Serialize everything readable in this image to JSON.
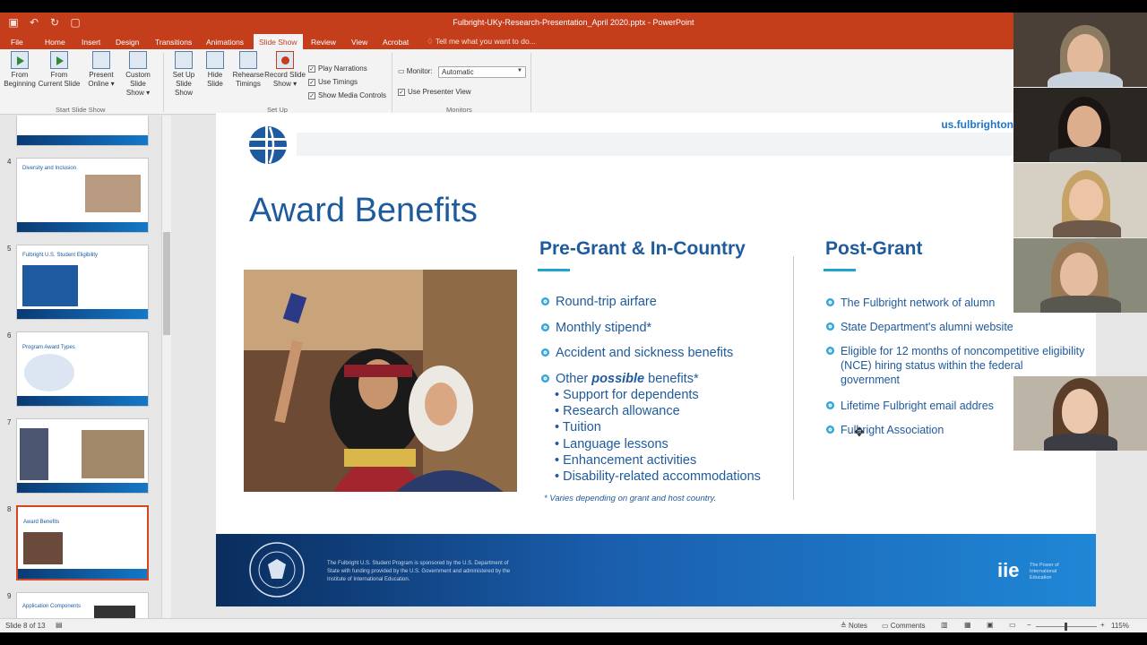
{
  "window": {
    "title": "Fulbright-UKy-Research-Presentation_April 2020.pptx  -  PowerPoint"
  },
  "tabs": [
    "File",
    "Home",
    "Insert",
    "Design",
    "Transitions",
    "Animations",
    "Slide Show",
    "Review",
    "View",
    "Acrobat"
  ],
  "active_tab": "Slide Show",
  "tell_me": "Tell me what you want to do...",
  "ribbon": {
    "start": {
      "from_beginning": [
        "From",
        "Beginning"
      ],
      "from_current": [
        "From",
        "Current Slide"
      ],
      "present_online": [
        "Present",
        "Online ▾"
      ],
      "custom": [
        "Custom Slide",
        "Show ▾"
      ],
      "group": "Start Slide Show"
    },
    "setup": {
      "setup_show": [
        "Set Up",
        "Slide Show"
      ],
      "hide": [
        "Hide",
        "Slide"
      ],
      "rehearse": [
        "Rehearse",
        "Timings"
      ],
      "record": [
        "Record Slide",
        "Show ▾"
      ],
      "group": "Set Up",
      "checks": [
        "Play Narrations",
        "Use Timings",
        "Show Media Controls"
      ]
    },
    "monitors": {
      "label": "Monitor:",
      "value": "Automatic",
      "presenter_view": "Use Presenter View",
      "group": "Monitors"
    }
  },
  "thumbnails": [
    {
      "num": "4",
      "title": "Diversity and Inclusion"
    },
    {
      "num": "5",
      "title": "Fulbright U.S. Student Eligibility"
    },
    {
      "num": "6",
      "title": "Program Award Types"
    },
    {
      "num": "7",
      "title": ""
    },
    {
      "num": "8",
      "title": "Award Benefits"
    },
    {
      "num": "9",
      "title": "Application Components"
    }
  ],
  "slide": {
    "url": "us.fulbrighton",
    "title": "Award Benefits",
    "col1_heading": "Pre-Grant & In-Country",
    "col1_bullets": [
      "Round-trip airfare",
      "Monthly stipend*",
      "Accident and sickness benefits"
    ],
    "other_prefix": "Other ",
    "other_em": "possible",
    "other_suffix": " benefits*",
    "sub_items": [
      "• Support for dependents",
      "• Research allowance",
      "• Tuition",
      "• Language lessons",
      "• Enhancement activities",
      "• Disability-related accommodations"
    ],
    "note": "* Varies depending on grant and host country.",
    "col2_heading": "Post-Grant",
    "col2_bullets": [
      "The Fulbright network of alumn",
      "State Department's alumni website",
      "Eligible for 12 months of noncompetitive eligibility (NCE) hiring status within the federal government",
      "Lifetime Fulbright email addres",
      "Fulbright Association"
    ],
    "disclaimer": "The Fulbright U.S. Student Program is sponsored by the U.S. Department of State with funding provided by the U.S. Government and administered by the Institute of International Education.",
    "iie": "iie",
    "iie_tag": "The Power of International Education"
  },
  "status": {
    "slide_of": "Slide 8 of 13",
    "notes": "Notes",
    "comments": "Comments",
    "zoom": "115%"
  }
}
